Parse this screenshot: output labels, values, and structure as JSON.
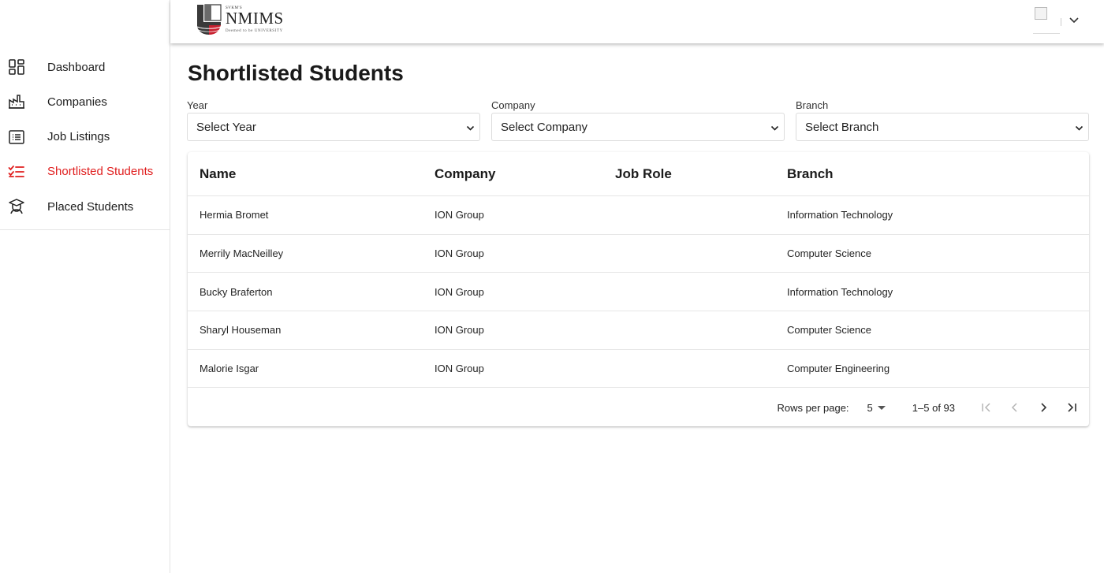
{
  "brand": {
    "small": "SVKM'S",
    "name": "NMIMS",
    "sub": "Deemed to be UNIVERSITY"
  },
  "sidebar": {
    "items": [
      {
        "label": "Dashboard",
        "icon": "dashboard-icon",
        "active": false
      },
      {
        "label": "Companies",
        "icon": "factory-icon",
        "active": false
      },
      {
        "label": "Job Listings",
        "icon": "list-icon",
        "active": false
      },
      {
        "label": "Shortlisted Students",
        "icon": "checklist-icon",
        "active": true
      },
      {
        "label": "Placed Students",
        "icon": "graduate-icon",
        "active": false
      }
    ]
  },
  "page": {
    "title": "Shortlisted Students"
  },
  "filters": {
    "year": {
      "label": "Year",
      "value": "Select Year"
    },
    "company": {
      "label": "Company",
      "value": "Select Company"
    },
    "branch": {
      "label": "Branch",
      "value": "Select Branch"
    }
  },
  "table": {
    "headers": {
      "name": "Name",
      "company": "Company",
      "role": "Job Role",
      "branch": "Branch"
    },
    "rows": [
      {
        "name": "Hermia Bromet",
        "company": "ION Group",
        "role": "",
        "branch": "Information Technology"
      },
      {
        "name": "Merrily MacNeilley",
        "company": "ION Group",
        "role": "",
        "branch": "Computer Science"
      },
      {
        "name": "Bucky Braferton",
        "company": "ION Group",
        "role": "",
        "branch": "Information Technology"
      },
      {
        "name": "Sharyl Houseman",
        "company": "ION Group",
        "role": "",
        "branch": "Computer Science"
      },
      {
        "name": "Malorie Isgar",
        "company": "ION Group",
        "role": "",
        "branch": "Computer Engineering"
      }
    ]
  },
  "pagination": {
    "rows_per_page_label": "Rows per page:",
    "rows_per_page": "5",
    "range": "1–5 of 93"
  },
  "colors": {
    "accent": "#e01e1e",
    "logo_red": "#c8202f",
    "logo_dark": "#3a3a3a"
  }
}
